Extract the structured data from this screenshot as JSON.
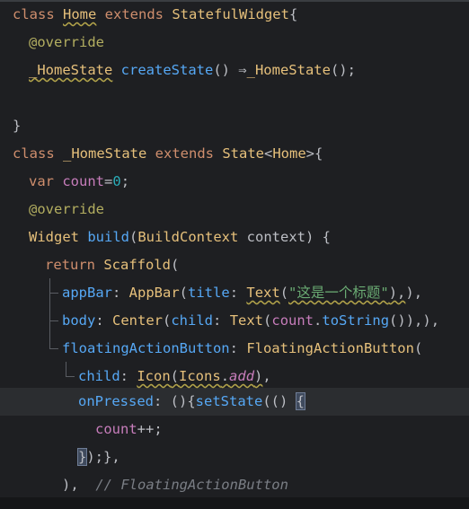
{
  "editor": {
    "lines": [
      {
        "id": "l1",
        "segments": [
          {
            "t": "class ",
            "c": "kw"
          },
          {
            "t": "Home",
            "c": "cls warn"
          },
          {
            "t": " extends ",
            "c": "kw"
          },
          {
            "t": "StatefulWidget",
            "c": "cls"
          },
          {
            "t": "{",
            "c": ""
          }
        ]
      },
      {
        "id": "l2",
        "segments": [
          {
            "t": "@override",
            "c": "ann"
          }
        ]
      },
      {
        "id": "l3",
        "segments": [
          {
            "t": "_HomeState",
            "c": "cls warn"
          },
          {
            "t": " createState",
            "c": "fn"
          },
          {
            "t": "() ⇒",
            "c": ""
          },
          {
            "t": "_HomeState",
            "c": "cls"
          },
          {
            "t": "();",
            "c": ""
          }
        ]
      },
      {
        "id": "l4",
        "segments": [
          {
            "t": "",
            "c": ""
          }
        ]
      },
      {
        "id": "l5",
        "segments": [
          {
            "t": "}",
            "c": ""
          }
        ]
      },
      {
        "id": "l6",
        "segments": [
          {
            "t": "class ",
            "c": "kw"
          },
          {
            "t": "_HomeState",
            "c": "cls"
          },
          {
            "t": " extends ",
            "c": "kw"
          },
          {
            "t": "State",
            "c": "cls"
          },
          {
            "t": "<",
            "c": ""
          },
          {
            "t": "Home",
            "c": "cls"
          },
          {
            "t": ">{",
            "c": ""
          }
        ]
      },
      {
        "id": "l7",
        "segments": [
          {
            "t": "var ",
            "c": "kw"
          },
          {
            "t": "count",
            "c": "prop"
          },
          {
            "t": "=",
            "c": ""
          },
          {
            "t": "0",
            "c": "num"
          },
          {
            "t": ";",
            "c": ""
          }
        ]
      },
      {
        "id": "l8",
        "segments": [
          {
            "t": "@override",
            "c": "ann"
          }
        ]
      },
      {
        "id": "l9",
        "segments": [
          {
            "t": "Widget",
            "c": "cls"
          },
          {
            "t": " build",
            "c": "fn"
          },
          {
            "t": "(",
            "c": ""
          },
          {
            "t": "BuildContext",
            "c": "cls"
          },
          {
            "t": " context) {",
            "c": ""
          }
        ]
      },
      {
        "id": "l10",
        "segments": [
          {
            "t": "return ",
            "c": "kw"
          },
          {
            "t": "Scaffold",
            "c": "cls"
          },
          {
            "t": "(",
            "c": ""
          }
        ]
      },
      {
        "id": "l11",
        "segments": [
          {
            "t": "appBar",
            "c": "fn"
          },
          {
            "t": ": ",
            "c": ""
          },
          {
            "t": "AppBar",
            "c": "cls"
          },
          {
            "t": "(",
            "c": ""
          },
          {
            "t": "title",
            "c": "fn"
          },
          {
            "t": ": ",
            "c": ""
          },
          {
            "t": "Text",
            "c": "cls warn"
          },
          {
            "t": "(",
            "c": ""
          },
          {
            "t": "\"这是一个标题\"",
            "c": "str warn"
          },
          {
            "t": "),",
            "c": "warn"
          },
          {
            "t": "),",
            "c": ""
          }
        ]
      },
      {
        "id": "l12",
        "segments": [
          {
            "t": "body",
            "c": "fn"
          },
          {
            "t": ": ",
            "c": ""
          },
          {
            "t": "Center",
            "c": "cls"
          },
          {
            "t": "(",
            "c": ""
          },
          {
            "t": "child",
            "c": "fn"
          },
          {
            "t": ": ",
            "c": ""
          },
          {
            "t": "Text",
            "c": "cls"
          },
          {
            "t": "(",
            "c": ""
          },
          {
            "t": "count",
            "c": "prop"
          },
          {
            "t": ".",
            "c": ""
          },
          {
            "t": "toString",
            "c": "fn"
          },
          {
            "t": "()),),",
            "c": ""
          }
        ]
      },
      {
        "id": "l13",
        "segments": [
          {
            "t": "floatingActionButton",
            "c": "fn"
          },
          {
            "t": ": ",
            "c": ""
          },
          {
            "t": "FloatingActionButton",
            "c": "cls"
          },
          {
            "t": "(",
            "c": ""
          }
        ]
      },
      {
        "id": "l14",
        "segments": [
          {
            "t": "child",
            "c": "fn"
          },
          {
            "t": ": ",
            "c": ""
          },
          {
            "t": "Icon",
            "c": "cls warn"
          },
          {
            "t": "(",
            "c": "warn"
          },
          {
            "t": "Icons",
            "c": "cls warn"
          },
          {
            "t": ".",
            "c": "warn"
          },
          {
            "t": "add",
            "c": "prop it warn"
          },
          {
            "t": ")",
            "c": "warn"
          },
          {
            "t": ",",
            "c": ""
          }
        ]
      },
      {
        "id": "l15",
        "segments": [
          {
            "t": "onPressed",
            "c": "fn"
          },
          {
            "t": ": (){",
            "c": ""
          },
          {
            "t": "setState",
            "c": "fn"
          },
          {
            "t": "(() ",
            "c": ""
          },
          {
            "t": "{",
            "c": "cursor-box"
          }
        ]
      },
      {
        "id": "l16",
        "segments": [
          {
            "t": "count",
            "c": "prop"
          },
          {
            "t": "++;",
            "c": ""
          }
        ]
      },
      {
        "id": "l17",
        "segments": [
          {
            "t": "}",
            "c": "cursor-box"
          },
          {
            "t": ");},",
            "c": ""
          }
        ]
      },
      {
        "id": "l18",
        "segments": [
          {
            "t": "),  ",
            "c": ""
          },
          {
            "t": "// FloatingActionButton",
            "c": "cmt"
          }
        ]
      }
    ]
  }
}
